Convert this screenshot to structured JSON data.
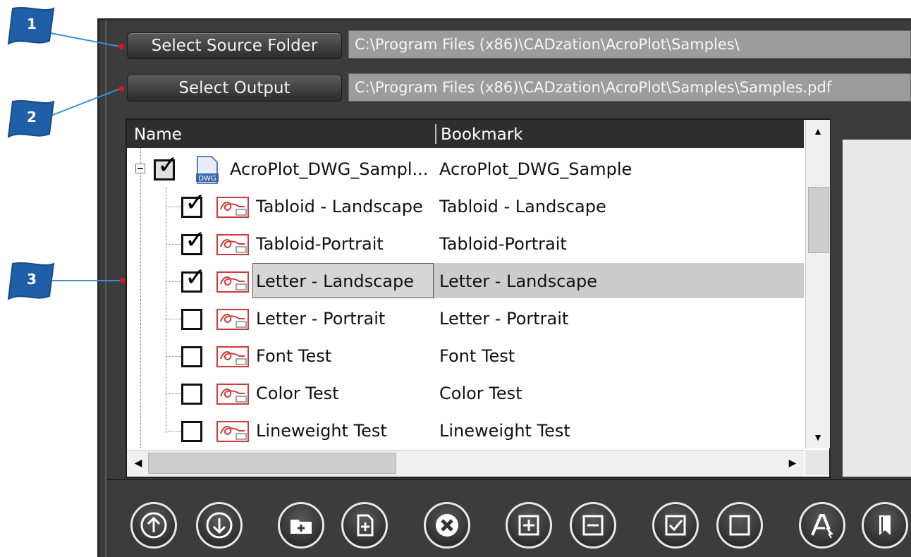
{
  "source": {
    "button_label": "Select Source Folder",
    "path": "C:\\Program Files (x86)\\CADzation\\AcroPlot\\Samples\\"
  },
  "output": {
    "button_label": "Select Output",
    "path": "C:\\Program Files (x86)\\CADzation\\AcroPlot\\Samples\\Samples.pdf"
  },
  "tree": {
    "columns": [
      "Name",
      "Bookmark"
    ],
    "root": {
      "name": "AcroPlot_DWG_Sampl...",
      "bookmark": "AcroPlot_DWG_Sample",
      "checked": true,
      "icon": "dwg-file-icon"
    },
    "items": [
      {
        "name": "Tabloid - Landscape",
        "bookmark": "Tabloid - Landscape",
        "checked": true
      },
      {
        "name": "Tabloid-Portrait",
        "bookmark": "Tabloid-Portrait",
        "checked": true
      },
      {
        "name": "Letter - Landscape",
        "bookmark": "Letter - Landscape",
        "checked": true,
        "selected": true
      },
      {
        "name": "Letter - Portrait",
        "bookmark": "Letter - Portrait",
        "checked": false
      },
      {
        "name": "Font Test",
        "bookmark": "Font Test",
        "checked": false
      },
      {
        "name": "Color Test",
        "bookmark": "Color Test",
        "checked": false
      },
      {
        "name": "Lineweight Test",
        "bookmark": "Lineweight Test",
        "checked": false
      }
    ]
  },
  "callouts": [
    "1",
    "2",
    "3"
  ],
  "toolbar": [
    "move-up-icon",
    "move-down-icon",
    "add-folder-icon",
    "add-file-icon",
    "remove-icon",
    "expand-all-icon",
    "collapse-all-icon",
    "check-all-icon",
    "uncheck-all-icon",
    "rename-icon",
    "bookmark-icon"
  ],
  "colors": {
    "panel": "#3c3c3c",
    "accent_callout": "#1f5fa8",
    "leader": "#3b8fd6",
    "dot": "#d11a1a"
  }
}
